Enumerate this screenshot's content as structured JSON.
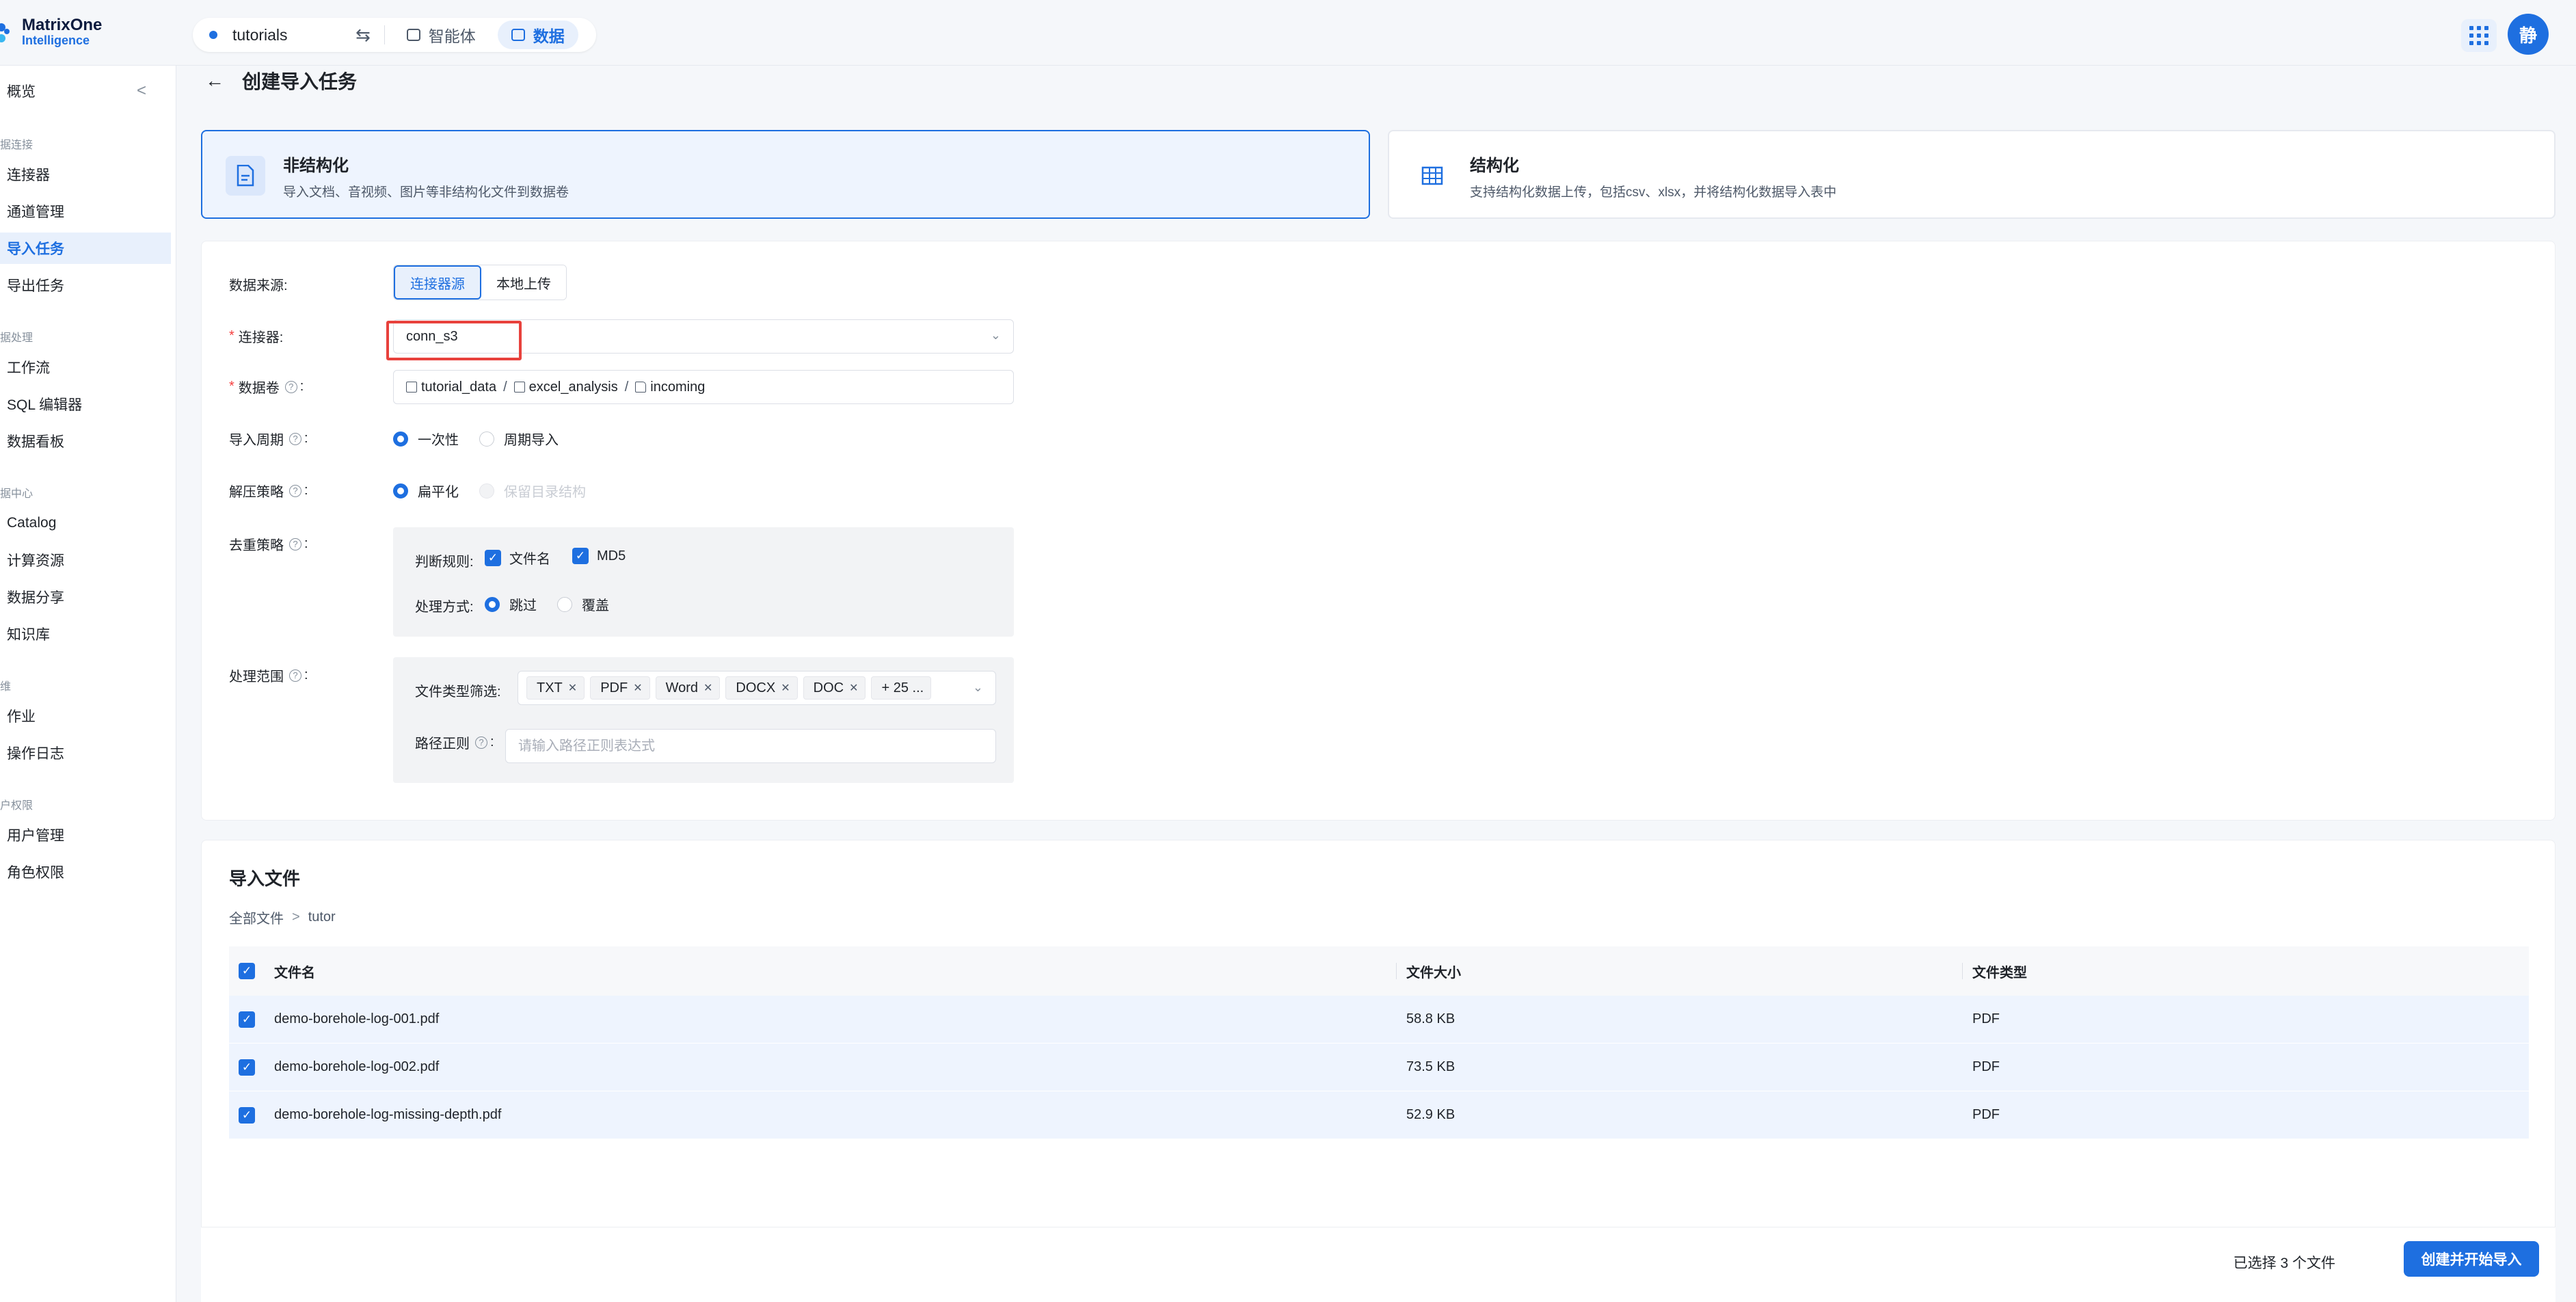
{
  "header": {
    "logo_line1": "MatrixOne",
    "logo_line2": "Intelligence",
    "workspace": "tutorials",
    "switch_icon": "⇆",
    "nav": [
      {
        "label": "智能体",
        "active": false
      },
      {
        "label": "数据",
        "active": true
      }
    ],
    "avatar_text": "静"
  },
  "sidebar": {
    "collapse_icon": "<",
    "overview": "概览",
    "groups": [
      {
        "title": "据连接",
        "items": [
          "连接器",
          "通道管理",
          "导入任务",
          "导出任务"
        ]
      },
      {
        "title": "据处理",
        "items": [
          "工作流",
          "SQL 编辑器",
          "数据看板"
        ]
      },
      {
        "title": "据中心",
        "items": [
          "Catalog",
          "计算资源",
          "数据分享",
          "知识库"
        ]
      },
      {
        "title": "维",
        "items": [
          "作业",
          "操作日志"
        ]
      },
      {
        "title": "户权限",
        "items": [
          "用户管理",
          "角色权限"
        ]
      }
    ],
    "active_item": "导入任务"
  },
  "page": {
    "back_icon": "←",
    "title": "创建导入任务"
  },
  "type_cards": [
    {
      "title": "非结构化",
      "desc": "导入文档、音视频、图片等非结构化文件到数据卷",
      "selected": true
    },
    {
      "title": "结构化",
      "desc": "支持结构化数据上传，包括csv、xlsx，并将结构化数据导入表中",
      "selected": false
    }
  ],
  "form": {
    "source_label": "数据来源:",
    "source_options": [
      "连接器源",
      "本地上传"
    ],
    "source_selected": "连接器源",
    "connector_label": "连接器:",
    "connector_value": "conn_s3",
    "volume_label": "数据卷",
    "volume_path": [
      "tutorial_data",
      "excel_analysis",
      "incoming"
    ],
    "period_label": "导入周期",
    "period_options": [
      "一次性",
      "周期导入"
    ],
    "period_selected": "一次性",
    "unzip_label": "解压策略",
    "unzip_options": [
      "扁平化",
      "保留目录结构"
    ],
    "unzip_selected": "扁平化",
    "dedup_label": "去重策略",
    "dedup_rule_label": "判断规则:",
    "dedup_rules": [
      "文件名",
      "MD5"
    ],
    "dedup_action_label": "处理方式:",
    "dedup_actions": [
      "跳过",
      "覆盖"
    ],
    "dedup_action_selected": "跳过",
    "scope_label": "处理范围",
    "filetype_label": "文件类型筛选:",
    "filetypes": [
      "TXT",
      "PDF",
      "Word",
      "DOCX",
      "DOC"
    ],
    "filetypes_more": "+ 25 ...",
    "path_regex_label": "路径正则",
    "path_regex_placeholder": "请输入路径正则表达式"
  },
  "files": {
    "title": "导入文件",
    "breadcrumb": [
      "全部文件",
      "tutor"
    ],
    "columns": [
      "文件名",
      "文件大小",
      "文件类型"
    ],
    "rows": [
      {
        "name": "demo-borehole-log-001.pdf",
        "size": "58.8 KB",
        "type": "PDF"
      },
      {
        "name": "demo-borehole-log-002.pdf",
        "size": "73.5 KB",
        "type": "PDF"
      },
      {
        "name": "demo-borehole-log-missing-depth.pdf",
        "size": "52.9 KB",
        "type": "PDF"
      }
    ]
  },
  "footer": {
    "selected_text": "已选择 3 个文件",
    "submit_label": "创建并开始导入"
  },
  "colors": {
    "primary": "#1e6fe0",
    "highlight": "#e8413c"
  }
}
